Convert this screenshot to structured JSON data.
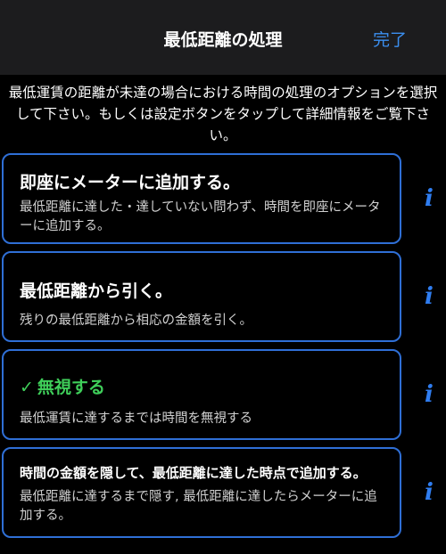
{
  "nav": {
    "title": "最低距離の処理",
    "done": "完了"
  },
  "instructions": "最低運賃の距離が未達の場合における時間の処理のオプションを選択して下さい。もしくは設定ボタンをタップして詳細情報をご覧下さい。",
  "options": [
    {
      "title": "即座にメーターに追加する。",
      "description": "最低距離に達した・達していない問わず、時間を即座にメーターに追加する。",
      "selected": false
    },
    {
      "title": "最低距離から引く。",
      "description": "残りの最低距離から相応の金額を引く。",
      "selected": false
    },
    {
      "title": "無視する",
      "description": "最低運賃に達するまでは時間を無視する",
      "selected": true,
      "check": "✓"
    },
    {
      "title": "時間の金額を隠して、最低距離に達した時点で追加する。",
      "description": "最低距離に達するまで隠す, 最低距離に達したらメーターに追加する。",
      "selected": false
    }
  ],
  "info_glyph": "i",
  "colors": {
    "accent": "#3b8ff0",
    "border": "#2f6fd6",
    "selected": "#3fcf5a",
    "navbar": "#1c1c1e"
  }
}
